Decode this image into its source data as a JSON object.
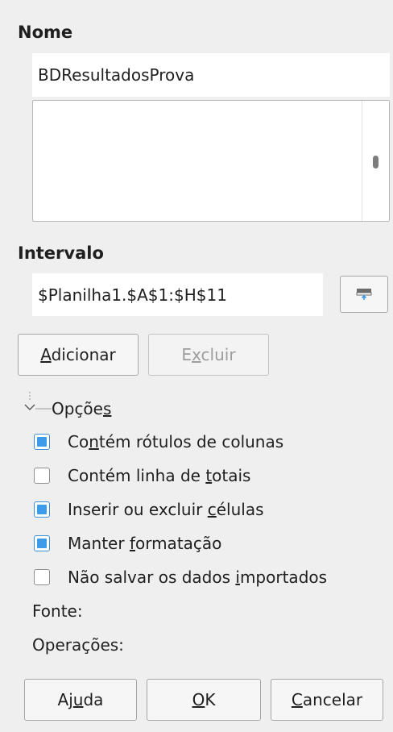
{
  "name_section": {
    "heading": "Nome",
    "name_value": "BDResultadosProva"
  },
  "range_section": {
    "heading": "Intervalo",
    "range_value": "$Planilha1.$A$1:$H$11",
    "shrink_button_icon": "shrink-range-icon"
  },
  "actions": {
    "add_prefix": "A",
    "add_rest": "dicionar",
    "delete_prefix": "E",
    "delete_mnemonic": "x",
    "delete_rest": "cluir"
  },
  "options": {
    "expander_label_pre": "Opçõe",
    "expander_label_mn": "s",
    "items": [
      {
        "pre": "Co",
        "mn": "n",
        "post": "tém rótulos de colunas",
        "checked": true
      },
      {
        "pre": "Contém linha de ",
        "mn": "t",
        "post": "otais",
        "checked": false
      },
      {
        "pre": "Inserir ou excluir ",
        "mn": "c",
        "post": "élulas",
        "checked": true
      },
      {
        "pre": "Manter ",
        "mn": "f",
        "post": "ormatação",
        "checked": true
      },
      {
        "pre": "Não salvar os dados ",
        "mn": "i",
        "post": "mportados",
        "checked": false
      }
    ],
    "source_label": "Fonte:",
    "operations_label": "Operações:"
  },
  "footer": {
    "help_pre": "Aj",
    "help_mn": "u",
    "help_post": "da",
    "ok_mn": "O",
    "ok_post": "K",
    "cancel_mn": "C",
    "cancel_post": "ancelar"
  },
  "colors": {
    "background": "#efefef",
    "checkbox_accent": "#3d9be9"
  }
}
